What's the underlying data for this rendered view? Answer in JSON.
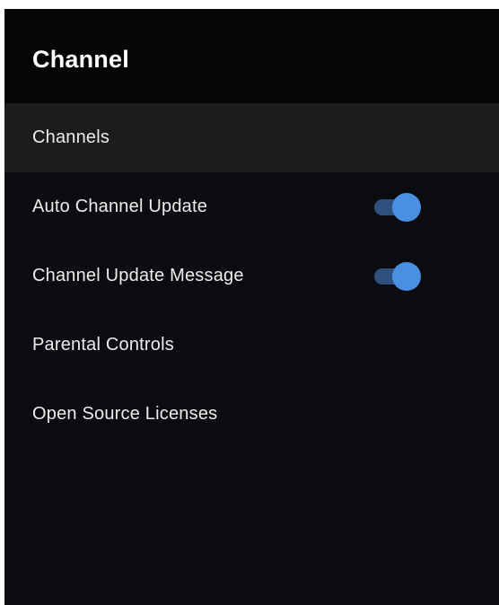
{
  "header": {
    "title": "Channel"
  },
  "menu": {
    "items": [
      {
        "label": "Channels",
        "selected": true
      },
      {
        "label": "Auto Channel Update",
        "toggle": true,
        "toggle_on": true
      },
      {
        "label": "Channel Update Message",
        "toggle": true,
        "toggle_on": true
      },
      {
        "label": "Parental Controls"
      },
      {
        "label": "Open Source Licenses"
      }
    ]
  },
  "colors": {
    "background": "#0b0c10",
    "header_background": "#050505",
    "selected_row": "#1c1c1e",
    "toggle_track": "#2f4f7c",
    "toggle_thumb": "#4a90e2"
  }
}
